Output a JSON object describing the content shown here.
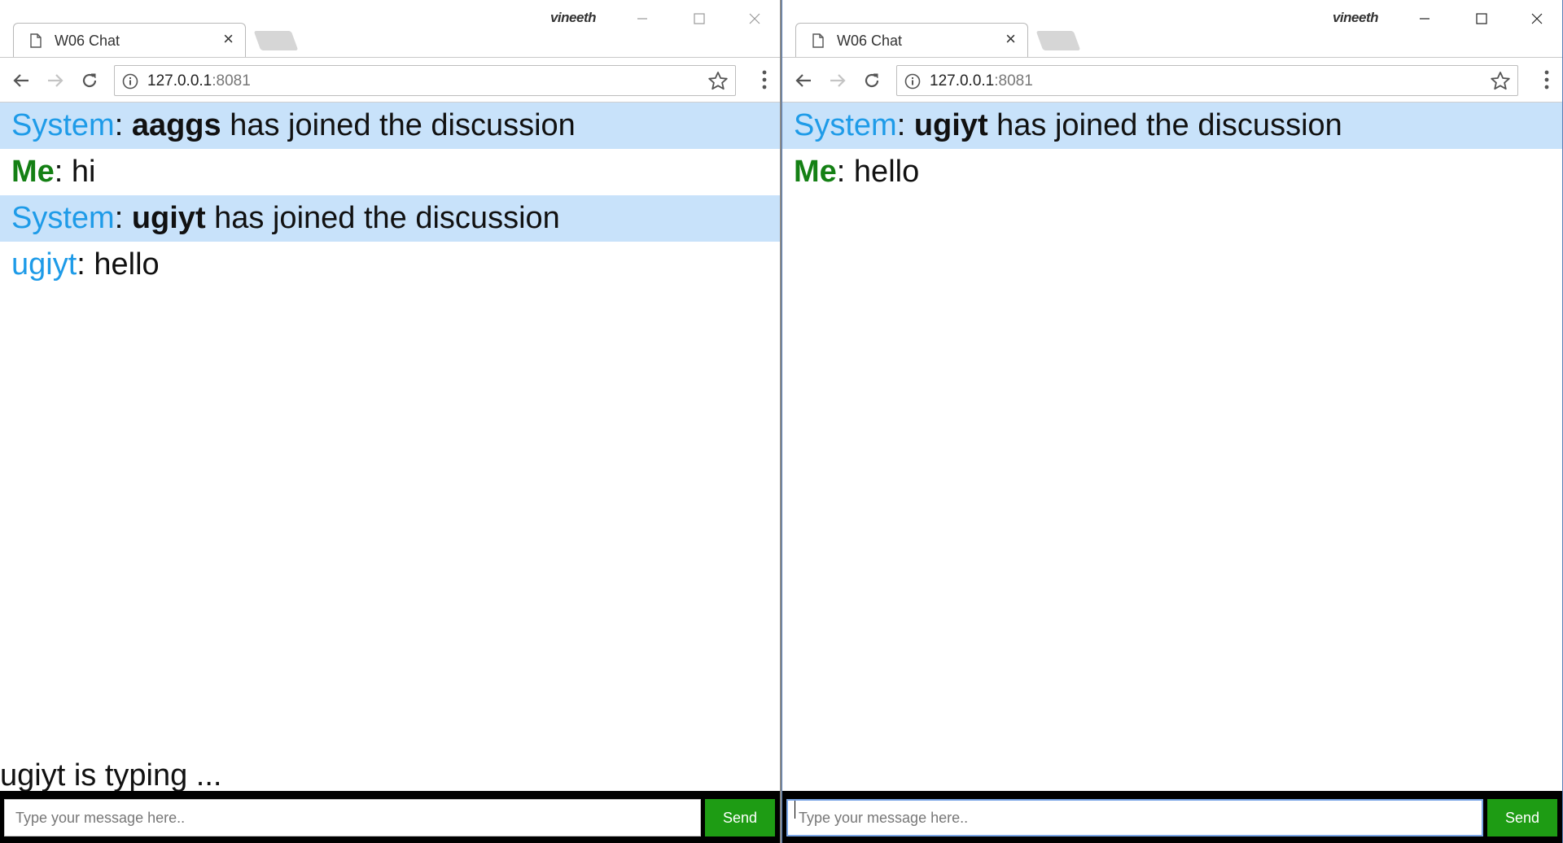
{
  "os": {
    "username": "vineeth"
  },
  "windows": [
    {
      "tab": {
        "title": "W06 Chat",
        "close": "×"
      },
      "address": {
        "host": "127.0.0.1",
        "port": ":8081"
      },
      "messages": [
        {
          "kind": "system",
          "sender": "System",
          "sep": ": ",
          "user": "aaggs",
          "text": " has joined the discussion"
        },
        {
          "kind": "me",
          "sender": "Me",
          "sep": ": ",
          "text": "hi"
        },
        {
          "kind": "system",
          "sender": "System",
          "sep": ": ",
          "user": "ugiyt",
          "text": " has joined the discussion"
        },
        {
          "kind": "user",
          "sender": "ugiyt",
          "sep": ": ",
          "text": "hello"
        }
      ],
      "typing_status": "ugiyt is typing ...",
      "composer": {
        "placeholder": "Type your message here..",
        "value": "",
        "send_label": "Send"
      }
    },
    {
      "tab": {
        "title": "W06 Chat",
        "close": "×"
      },
      "address": {
        "host": "127.0.0.1",
        "port": ":8081"
      },
      "messages": [
        {
          "kind": "system",
          "sender": "System",
          "sep": ": ",
          "user": "ugiyt",
          "text": " has joined the discussion"
        },
        {
          "kind": "me",
          "sender": "Me",
          "sep": ": ",
          "text": "hello"
        }
      ],
      "typing_status": "",
      "composer": {
        "placeholder": "Type your message here..",
        "value": "",
        "send_label": "Send"
      }
    }
  ],
  "colors": {
    "system_sender": "#1e9be8",
    "me_sender": "#148014",
    "system_row_bg": "#c8e2fa",
    "send_button": "#1e9c14"
  },
  "icons": [
    "page-icon",
    "back-arrow-icon",
    "forward-arrow-icon",
    "reload-icon",
    "info-icon",
    "star-icon",
    "menu-dots-icon",
    "minimize-icon",
    "maximize-icon",
    "close-icon"
  ]
}
